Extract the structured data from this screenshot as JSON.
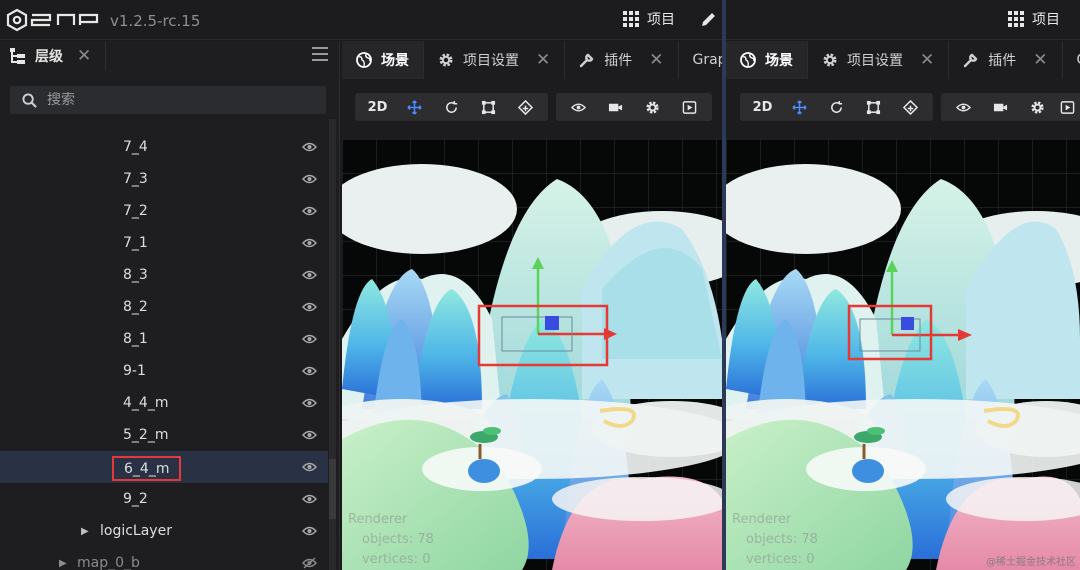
{
  "app": {
    "version": "v1.2.5-rc.15",
    "project_label": "项目"
  },
  "colors": {
    "accent_blue": "#4b8dff",
    "selection_bg": "#283244",
    "highlight_red": "#e53935",
    "gizmo_green": "#5bd35b",
    "gizmo_red": "#e53935"
  },
  "left_panel": {
    "tab_label": "层级",
    "search_placeholder": "搜索",
    "rows": [
      {
        "name": "7_4"
      },
      {
        "name": "7_3"
      },
      {
        "name": "7_2"
      },
      {
        "name": "7_1"
      },
      {
        "name": "8_3"
      },
      {
        "name": "8_2"
      },
      {
        "name": "8_1"
      },
      {
        "name": "9-1"
      },
      {
        "name": "4_4_m"
      },
      {
        "name": "5_2_m"
      },
      {
        "name": "6_4_m",
        "selected": true
      },
      {
        "name": "9_2"
      },
      {
        "name": "logicLayer",
        "collapsed": true
      },
      {
        "name": "map_0_b",
        "collapsed": true,
        "hidden": true
      }
    ]
  },
  "pane_left": {
    "tabs": [
      {
        "icon": "globe-icon",
        "label": "场景",
        "active": true
      },
      {
        "icon": "gear-icon",
        "label": "项目设置"
      },
      {
        "icon": "wrench-icon",
        "label": "插件"
      },
      {
        "label": "Grapl"
      }
    ],
    "toolbar_mode": "2D",
    "stats": {
      "title": "Renderer",
      "objects_label": "objects:",
      "objects": "78",
      "vertices_label": "vertices:",
      "vertices": "0"
    }
  },
  "pane_right": {
    "tabs": [
      {
        "icon": "globe-icon",
        "label": "场景",
        "active": true
      },
      {
        "icon": "gear-icon",
        "label": "项目设置"
      },
      {
        "icon": "wrench-icon",
        "label": "插件"
      },
      {
        "label": "G"
      }
    ],
    "toolbar_mode": "2D",
    "stats": {
      "title": "Renderer",
      "objects_label": "objects:",
      "objects": "78",
      "vertices_label": "vertices:",
      "vertices": "0"
    },
    "watermark": "@稀土掘金技术社区"
  }
}
